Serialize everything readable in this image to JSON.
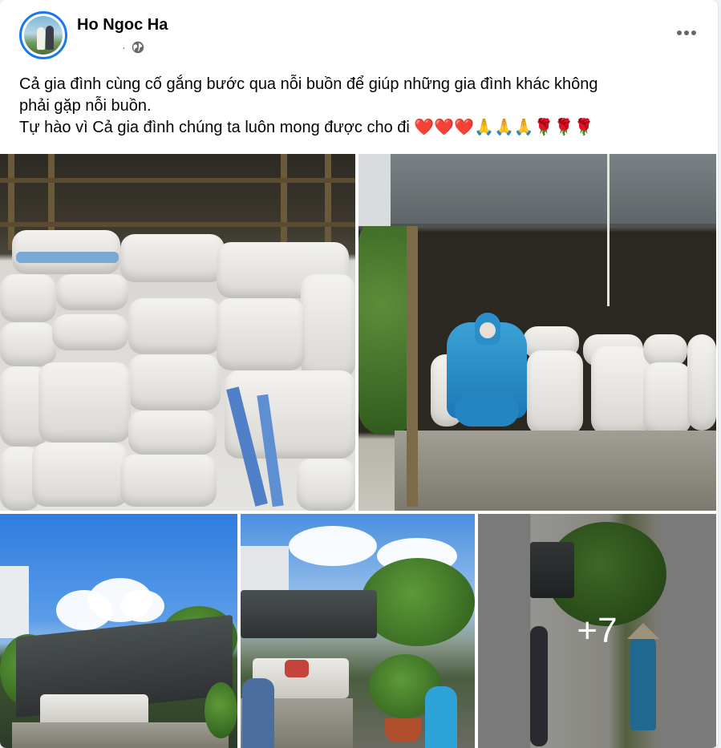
{
  "post": {
    "author": "Ho Ngoc Ha",
    "meta_separator": "·",
    "text_lines": [
      "Cả gia đình cùng cố gắng bước qua nỗi buồn để giúp những gia đình khác không",
      "phải gặp nỗi buồn.",
      "Tự hào vì Cả gia đình chúng ta luôn mong được cho đi ❤️❤️❤️🙏🙏🙏🌹🌹🌹"
    ],
    "more_photos_label": "+7"
  },
  "icons": {
    "privacy": "globe-icon",
    "menu": "more-options-icon"
  },
  "colors": {
    "avatar_ring": "#1877f2",
    "secondary_text": "#65676b"
  }
}
